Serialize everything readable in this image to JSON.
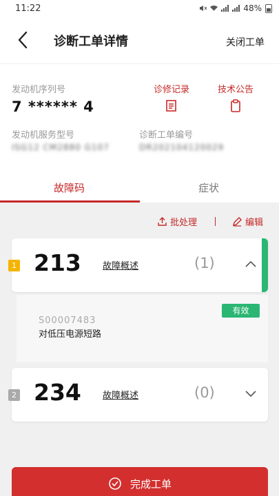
{
  "statusbar": {
    "time": "11:22",
    "battery": "48%"
  },
  "header": {
    "title": "诊断工单详情",
    "close_label": "关闭工单"
  },
  "info": {
    "serial_label": "发动机序列号",
    "serial_value": "7 ****** 4",
    "service_model_label": "发动机服务型号",
    "service_model_value": "ISG12 CM2880 G107",
    "work_order_label": "诊断工单编号",
    "work_order_value": "DR202104120029",
    "repair_record_label": "诊修记录",
    "tech_bulletin_label": "技术公告"
  },
  "tabs": {
    "fault_code": "故障码",
    "symptom": "症状"
  },
  "toolbar": {
    "batch_label": "批处理",
    "edit_label": "编辑"
  },
  "faults": [
    {
      "index": "1",
      "code": "213",
      "overview": "故障概述",
      "count": "(1)",
      "detail": {
        "code": "S00007483",
        "description": "对低压电源短路",
        "status": "有效"
      }
    },
    {
      "index": "2",
      "code": "234",
      "overview": "故障概述",
      "count": "(0)"
    }
  ],
  "footer": {
    "complete_label": "完成工单"
  },
  "colors": {
    "accent": "#c62828",
    "valid_green": "#2bb673",
    "index_yellow": "#f5b400"
  }
}
